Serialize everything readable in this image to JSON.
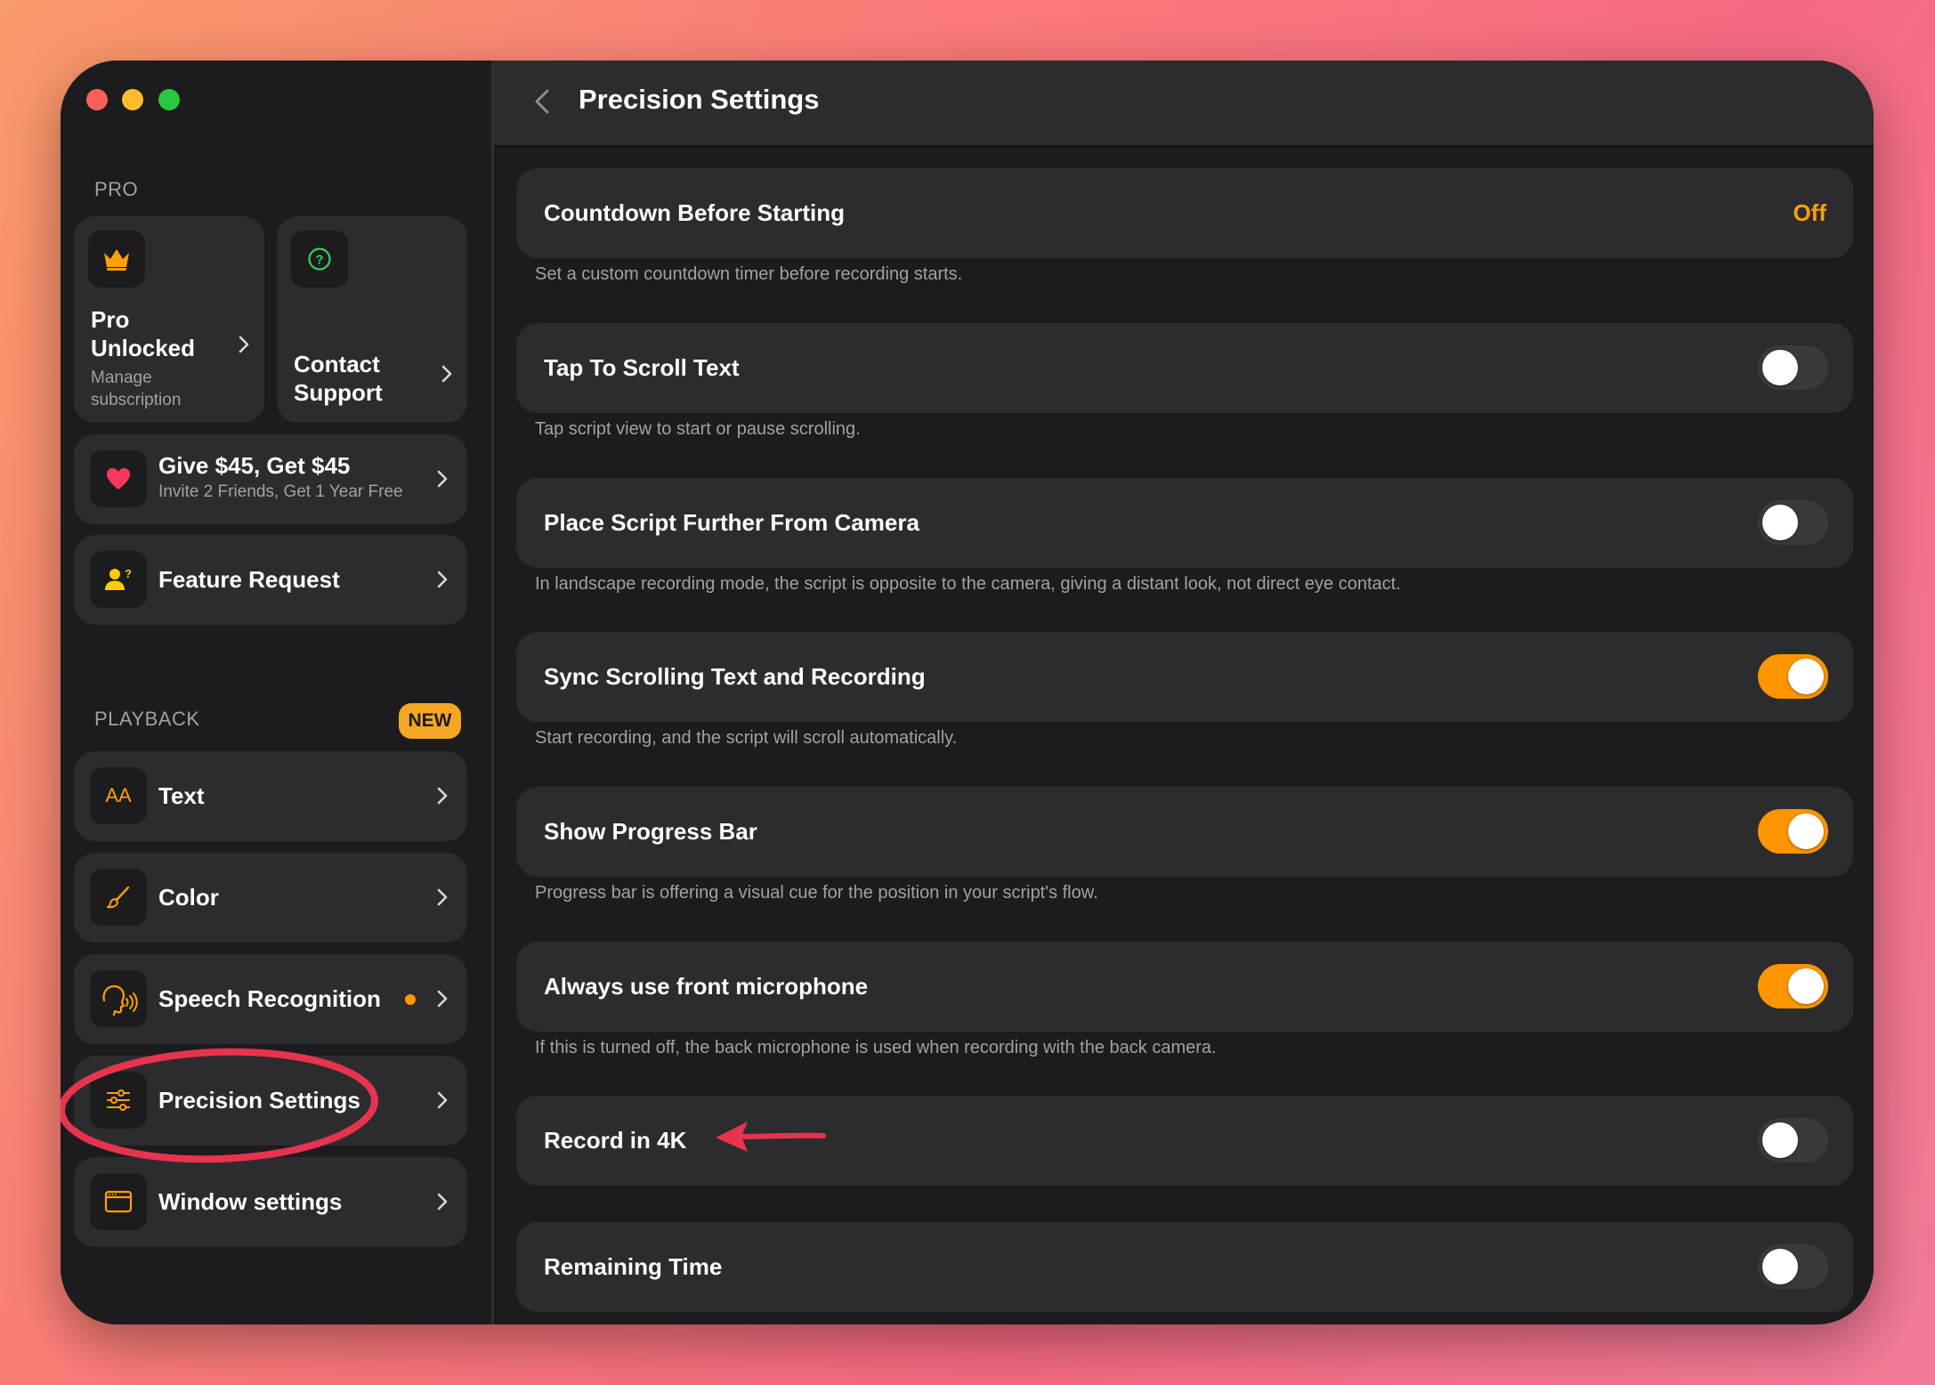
{
  "sidebar": {
    "pro_label": "PRO",
    "pro_card": {
      "title": "Pro Unlocked",
      "subtitle": "Manage subscription"
    },
    "contact_card": {
      "title": "Contact Support"
    },
    "give_card": {
      "title": "Give $45, Get $45",
      "subtitle": "Invite 2 Friends, Get 1 Year Free"
    },
    "feature_card": {
      "title": "Feature Request"
    },
    "playback_label": "PLAYBACK",
    "new_badge": "NEW",
    "items": [
      {
        "label": "Text",
        "icon": "text-size-icon",
        "icon_text": "AA"
      },
      {
        "label": "Color",
        "icon": "brush-icon"
      },
      {
        "label": "Speech Recognition",
        "icon": "speech-icon"
      },
      {
        "label": "Precision Settings",
        "icon": "sliders-icon"
      },
      {
        "label": "Window settings",
        "icon": "window-icon"
      }
    ]
  },
  "main": {
    "title": "Precision Settings",
    "rows": [
      {
        "title": "Countdown Before Starting",
        "value": "Off",
        "desc": "Set a custom countdown timer before recording starts."
      },
      {
        "title": "Tap To Scroll Text",
        "on": false,
        "desc": "Tap script view to start or pause scrolling."
      },
      {
        "title": "Place Script Further From Camera",
        "on": false,
        "desc": "In landscape recording mode, the script is opposite to the camera, giving a distant look, not direct eye contact."
      },
      {
        "title": "Sync Scrolling Text and Recording",
        "on": true,
        "desc": "Start recording, and the script will scroll automatically."
      },
      {
        "title": "Show Progress Bar",
        "on": true,
        "desc": "Progress bar is offering a visual cue for the position in your script's flow."
      },
      {
        "title": "Always use front microphone",
        "on": true,
        "desc": "If this is turned off, the back microphone is used when recording with the back camera."
      },
      {
        "title": "Record in 4K",
        "on": false
      },
      {
        "title": "Remaining Time",
        "on": false
      }
    ]
  },
  "colors": {
    "accent": "#ff9500",
    "annotation": "#e8334f",
    "background": "#1c1c1e",
    "card": "#2c2c2e"
  }
}
